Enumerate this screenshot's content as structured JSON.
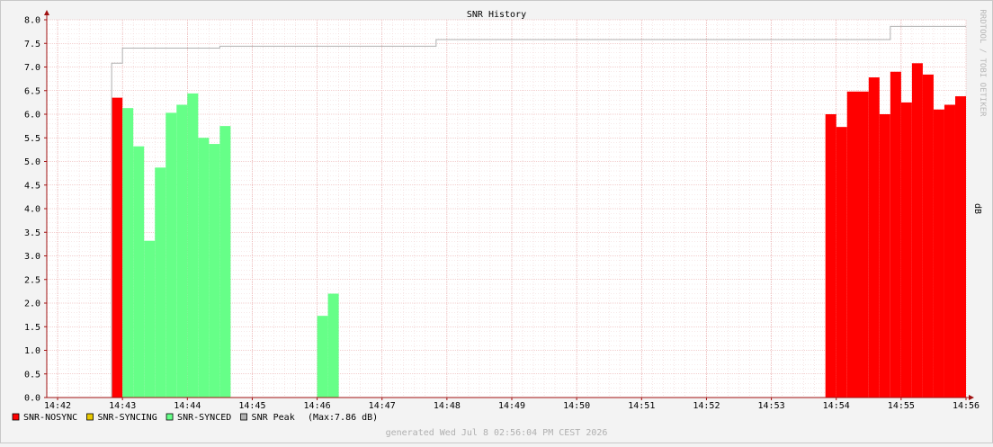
{
  "chart_data": {
    "type": "area",
    "title": "SNR History",
    "ylabel": "dB",
    "watermark": "RRDTOOL / TOBI OETIKER",
    "footer": "generated Wed Jul  8 02:56:04 PM CEST 2026",
    "ylim": [
      0,
      8.0
    ],
    "y_ticks": [
      "0.0",
      "0.5",
      "1.0",
      "1.5",
      "2.0",
      "2.5",
      "3.0",
      "3.5",
      "4.0",
      "4.5",
      "5.0",
      "5.5",
      "6.0",
      "6.5",
      "7.0",
      "7.5",
      "8.0"
    ],
    "x_ticks": [
      "14:42",
      "14:43",
      "14:44",
      "14:45",
      "14:46",
      "14:47",
      "14:48",
      "14:49",
      "14:50",
      "14:51",
      "14:52",
      "14:53",
      "14:54",
      "14:55",
      "14:56"
    ],
    "grid": true,
    "colors": {
      "background": "#f3f3f3",
      "canvas": "#ffffff",
      "grid_major": "#e8a0a0",
      "grid_minor": "#f0d4d4",
      "axis": "#a01010",
      "nosync": "#ff0000",
      "syncing": "#e8c800",
      "synced": "#66ff88",
      "peak": "#b0b0b0"
    },
    "series": [
      {
        "name": "SNR-NOSYNC",
        "color": "#ff0000",
        "steps": [
          {
            "t0": "14:42:50",
            "t1": "14:43:00",
            "value": 6.35
          },
          {
            "t0": "14:53:50",
            "t1": "14:54:00",
            "value": 6.0
          },
          {
            "t0": "14:54:00",
            "t1": "14:54:10",
            "value": 5.73
          },
          {
            "t0": "14:54:10",
            "t1": "14:54:30",
            "value": 6.48
          },
          {
            "t0": "14:54:30",
            "t1": "14:54:40",
            "value": 6.78
          },
          {
            "t0": "14:54:40",
            "t1": "14:54:50",
            "value": 6.0
          },
          {
            "t0": "14:54:50",
            "t1": "14:55:00",
            "value": 6.9
          },
          {
            "t0": "14:55:00",
            "t1": "14:55:10",
            "value": 6.25
          },
          {
            "t0": "14:55:10",
            "t1": "14:55:20",
            "value": 7.08
          },
          {
            "t0": "14:55:20",
            "t1": "14:55:30",
            "value": 6.84
          },
          {
            "t0": "14:55:30",
            "t1": "14:55:40",
            "value": 6.1
          },
          {
            "t0": "14:55:40",
            "t1": "14:55:50",
            "value": 6.2
          },
          {
            "t0": "14:55:50",
            "t1": "14:56:00",
            "value": 6.38
          }
        ]
      },
      {
        "name": "SNR-SYNCING",
        "color": "#e8c800",
        "steps": []
      },
      {
        "name": "SNR-SYNCED",
        "color": "#66ff88",
        "steps": [
          {
            "t0": "14:43:00",
            "t1": "14:43:10",
            "value": 6.13
          },
          {
            "t0": "14:43:10",
            "t1": "14:43:20",
            "value": 5.32
          },
          {
            "t0": "14:43:20",
            "t1": "14:43:30",
            "value": 3.32
          },
          {
            "t0": "14:43:30",
            "t1": "14:43:40",
            "value": 4.87
          },
          {
            "t0": "14:43:40",
            "t1": "14:43:50",
            "value": 6.03
          },
          {
            "t0": "14:43:50",
            "t1": "14:44:00",
            "value": 6.2
          },
          {
            "t0": "14:44:00",
            "t1": "14:44:10",
            "value": 6.44
          },
          {
            "t0": "14:44:10",
            "t1": "14:44:20",
            "value": 5.5
          },
          {
            "t0": "14:44:20",
            "t1": "14:44:30",
            "value": 5.37
          },
          {
            "t0": "14:44:30",
            "t1": "14:44:40",
            "value": 5.75
          },
          {
            "t0": "14:46:00",
            "t1": "14:46:10",
            "value": 1.73
          },
          {
            "t0": "14:46:10",
            "t1": "14:46:20",
            "value": 2.2
          }
        ]
      },
      {
        "name": "SNR Peak",
        "color": "#b0b0b0",
        "label_suffix": "(Max:7.86 dB)",
        "max": 7.86,
        "line": [
          {
            "t": "14:42:50",
            "value": 0
          },
          {
            "t": "14:42:50",
            "value": 7.08
          },
          {
            "t": "14:43:00",
            "value": 7.08
          },
          {
            "t": "14:43:00",
            "value": 7.4
          },
          {
            "t": "14:44:30",
            "value": 7.4
          },
          {
            "t": "14:44:30",
            "value": 7.44
          },
          {
            "t": "14:47:50",
            "value": 7.44
          },
          {
            "t": "14:47:50",
            "value": 7.58
          },
          {
            "t": "14:54:50",
            "value": 7.58
          },
          {
            "t": "14:54:50",
            "value": 7.86
          },
          {
            "t": "14:56:00",
            "value": 7.86
          }
        ]
      }
    ]
  }
}
